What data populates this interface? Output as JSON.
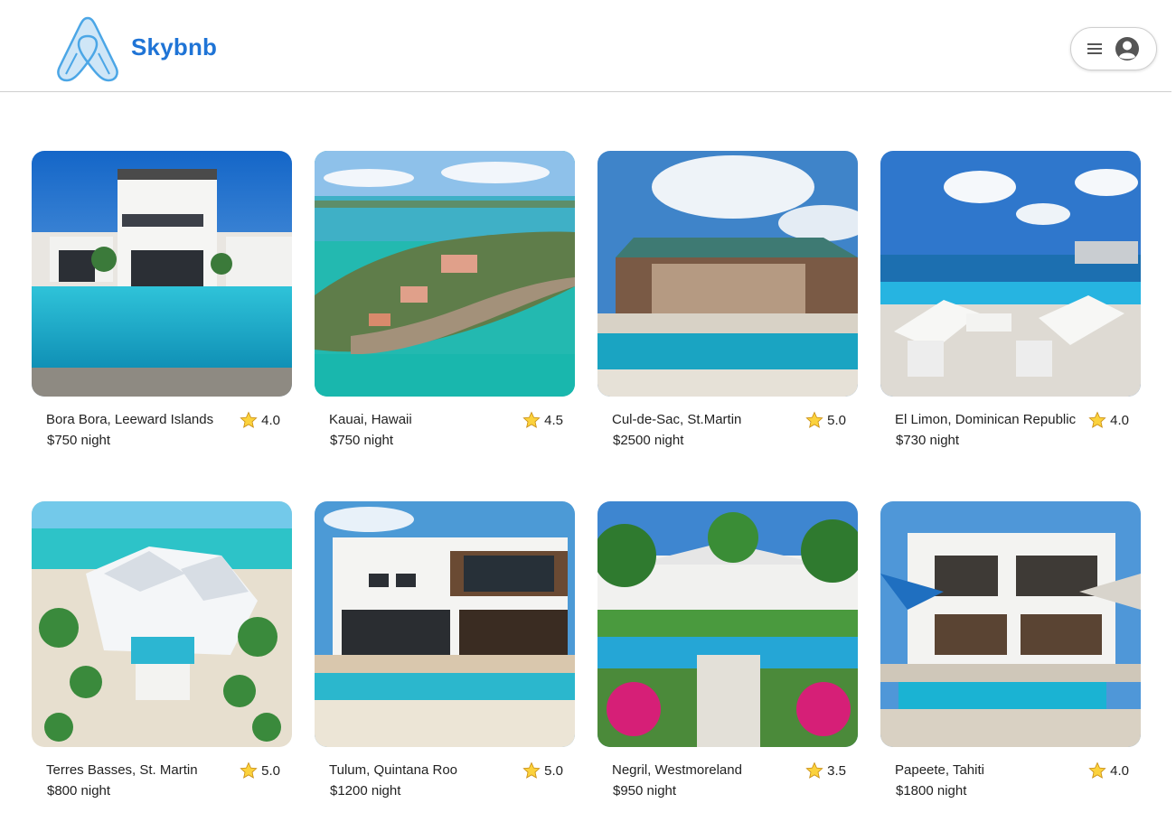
{
  "brand": {
    "name": "Skybnb",
    "logo_icon": "airbnb-logo-icon",
    "color": "#1f74d6"
  },
  "header": {
    "menu_icon": "hamburger-menu-icon",
    "profile_icon": "user-avatar-icon"
  },
  "listings": [
    {
      "location": "Bora Bora, Leeward Islands",
      "price": "$750 night",
      "rating": "4.0"
    },
    {
      "location": "Kauai, Hawaii",
      "price": "$750 night",
      "rating": "4.5"
    },
    {
      "location": "Cul-de-Sac, St.Martin",
      "price": "$2500 night",
      "rating": "5.0"
    },
    {
      "location": "El Limon, Dominican Republic",
      "price": "$730 night",
      "rating": "4.0"
    },
    {
      "location": "Terres Basses, St. Martin",
      "price": "$800 night",
      "rating": "5.0"
    },
    {
      "location": "Tulum, Quintana Roo",
      "price": "$1200 night",
      "rating": "5.0"
    },
    {
      "location": "Negril, Westmoreland",
      "price": "$950 night",
      "rating": "3.5"
    },
    {
      "location": "Papeete, Tahiti",
      "price": "$1800 night",
      "rating": "4.0"
    }
  ],
  "rating_icon": "star-icon"
}
